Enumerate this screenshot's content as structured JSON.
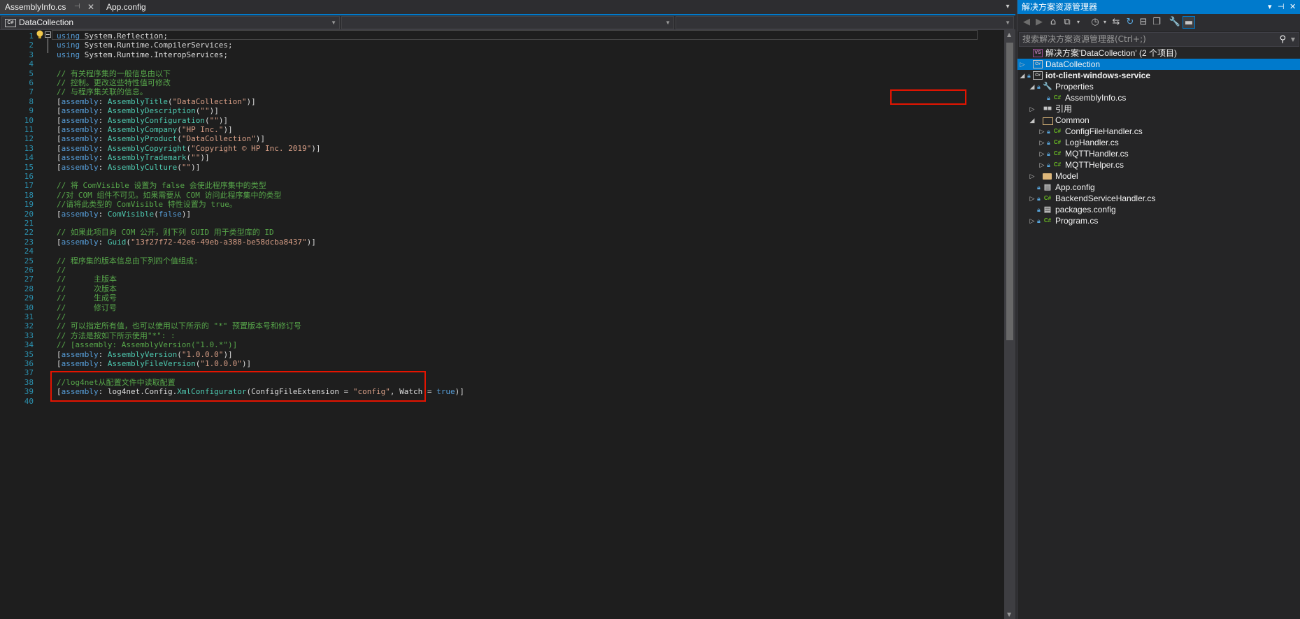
{
  "editor": {
    "tabs": [
      {
        "label": "AssemblyInfo.cs",
        "active": true
      },
      {
        "label": "App.config",
        "active": false
      }
    ],
    "nav": {
      "project": "DataCollection",
      "type": "",
      "member": ""
    },
    "lines": [
      {
        "n": "1",
        "segs": [
          [
            "kw",
            "using"
          ],
          [
            "pl",
            " System.Reflection;"
          ]
        ]
      },
      {
        "n": "2",
        "segs": [
          [
            "kw",
            "using"
          ],
          [
            "pl",
            " System.Runtime.CompilerServices;"
          ]
        ]
      },
      {
        "n": "3",
        "segs": [
          [
            "kw",
            "using"
          ],
          [
            "pl",
            " System.Runtime.InteropServices;"
          ]
        ]
      },
      {
        "n": "4",
        "segs": []
      },
      {
        "n": "5",
        "segs": [
          [
            "cm",
            "// 有关程序集的一般信息由以下"
          ]
        ]
      },
      {
        "n": "6",
        "segs": [
          [
            "cm",
            "// 控制。更改这些特性值可修改"
          ]
        ]
      },
      {
        "n": "7",
        "segs": [
          [
            "cm",
            "// 与程序集关联的信息。"
          ]
        ]
      },
      {
        "n": "8",
        "segs": [
          [
            "pl",
            "["
          ],
          [
            "kw",
            "assembly"
          ],
          [
            "pl",
            ": "
          ],
          [
            "ty",
            "AssemblyTitle"
          ],
          [
            "pl",
            "("
          ],
          [
            "st",
            "\"DataCollection\""
          ],
          [
            "pl",
            ")]"
          ]
        ]
      },
      {
        "n": "9",
        "segs": [
          [
            "pl",
            "["
          ],
          [
            "kw",
            "assembly"
          ],
          [
            "pl",
            ": "
          ],
          [
            "ty",
            "AssemblyDescription"
          ],
          [
            "pl",
            "("
          ],
          [
            "st",
            "\"\""
          ],
          [
            "pl",
            ")]"
          ]
        ]
      },
      {
        "n": "10",
        "segs": [
          [
            "pl",
            "["
          ],
          [
            "kw",
            "assembly"
          ],
          [
            "pl",
            ": "
          ],
          [
            "ty",
            "AssemblyConfiguration"
          ],
          [
            "pl",
            "("
          ],
          [
            "st",
            "\"\""
          ],
          [
            "pl",
            ")]"
          ]
        ]
      },
      {
        "n": "11",
        "segs": [
          [
            "pl",
            "["
          ],
          [
            "kw",
            "assembly"
          ],
          [
            "pl",
            ": "
          ],
          [
            "ty",
            "AssemblyCompany"
          ],
          [
            "pl",
            "("
          ],
          [
            "st",
            "\"HP Inc.\""
          ],
          [
            "pl",
            ")]"
          ]
        ]
      },
      {
        "n": "12",
        "segs": [
          [
            "pl",
            "["
          ],
          [
            "kw",
            "assembly"
          ],
          [
            "pl",
            ": "
          ],
          [
            "ty",
            "AssemblyProduct"
          ],
          [
            "pl",
            "("
          ],
          [
            "st",
            "\"DataCollection\""
          ],
          [
            "pl",
            ")]"
          ]
        ]
      },
      {
        "n": "13",
        "segs": [
          [
            "pl",
            "["
          ],
          [
            "kw",
            "assembly"
          ],
          [
            "pl",
            ": "
          ],
          [
            "ty",
            "AssemblyCopyright"
          ],
          [
            "pl",
            "("
          ],
          [
            "st",
            "\"Copyright © HP Inc. 2019\""
          ],
          [
            "pl",
            ")]"
          ]
        ]
      },
      {
        "n": "14",
        "segs": [
          [
            "pl",
            "["
          ],
          [
            "kw",
            "assembly"
          ],
          [
            "pl",
            ": "
          ],
          [
            "ty",
            "AssemblyTrademark"
          ],
          [
            "pl",
            "("
          ],
          [
            "st",
            "\"\""
          ],
          [
            "pl",
            ")]"
          ]
        ]
      },
      {
        "n": "15",
        "segs": [
          [
            "pl",
            "["
          ],
          [
            "kw",
            "assembly"
          ],
          [
            "pl",
            ": "
          ],
          [
            "ty",
            "AssemblyCulture"
          ],
          [
            "pl",
            "("
          ],
          [
            "st",
            "\"\""
          ],
          [
            "pl",
            ")]"
          ]
        ]
      },
      {
        "n": "16",
        "segs": []
      },
      {
        "n": "17",
        "segs": [
          [
            "cm",
            "// 将 ComVisible 设置为 false 会使此程序集中的类型"
          ]
        ]
      },
      {
        "n": "18",
        "segs": [
          [
            "cm",
            "//对 COM 组件不可见。如果需要从 COM 访问此程序集中的类型"
          ]
        ]
      },
      {
        "n": "19",
        "segs": [
          [
            "cm",
            "//请将此类型的 ComVisible 特性设置为 true。"
          ]
        ]
      },
      {
        "n": "20",
        "segs": [
          [
            "pl",
            "["
          ],
          [
            "kw",
            "assembly"
          ],
          [
            "pl",
            ": "
          ],
          [
            "ty",
            "ComVisible"
          ],
          [
            "pl",
            "("
          ],
          [
            "kw",
            "false"
          ],
          [
            "pl",
            ")]"
          ]
        ]
      },
      {
        "n": "21",
        "segs": []
      },
      {
        "n": "22",
        "segs": [
          [
            "cm",
            "// 如果此项目向 COM 公开，则下列 GUID 用于类型库的 ID"
          ]
        ]
      },
      {
        "n": "23",
        "segs": [
          [
            "pl",
            "["
          ],
          [
            "kw",
            "assembly"
          ],
          [
            "pl",
            ": "
          ],
          [
            "ty",
            "Guid"
          ],
          [
            "pl",
            "("
          ],
          [
            "st",
            "\"13f27f72-42e6-49eb-a388-be58dcba8437\""
          ],
          [
            "pl",
            ")]"
          ]
        ]
      },
      {
        "n": "24",
        "segs": []
      },
      {
        "n": "25",
        "segs": [
          [
            "cm",
            "// 程序集的版本信息由下列四个值组成:"
          ]
        ]
      },
      {
        "n": "26",
        "segs": [
          [
            "cm",
            "//"
          ]
        ]
      },
      {
        "n": "27",
        "segs": [
          [
            "cm",
            "//      主版本"
          ]
        ]
      },
      {
        "n": "28",
        "segs": [
          [
            "cm",
            "//      次版本"
          ]
        ]
      },
      {
        "n": "29",
        "segs": [
          [
            "cm",
            "//      生成号"
          ]
        ]
      },
      {
        "n": "30",
        "segs": [
          [
            "cm",
            "//      修订号"
          ]
        ]
      },
      {
        "n": "31",
        "segs": [
          [
            "cm",
            "//"
          ]
        ]
      },
      {
        "n": "32",
        "segs": [
          [
            "cm",
            "// 可以指定所有值，也可以使用以下所示的 \"*\" 预置版本号和修订号"
          ]
        ]
      },
      {
        "n": "33",
        "segs": [
          [
            "cm",
            "// 方法是按如下所示使用\"*\": :"
          ]
        ]
      },
      {
        "n": "34",
        "segs": [
          [
            "cm",
            "// [assembly: AssemblyVersion(\"1.0.*\")]"
          ]
        ]
      },
      {
        "n": "35",
        "segs": [
          [
            "pl",
            "["
          ],
          [
            "kw",
            "assembly"
          ],
          [
            "pl",
            ": "
          ],
          [
            "ty",
            "AssemblyVersion"
          ],
          [
            "pl",
            "("
          ],
          [
            "st",
            "\"1.0.0.0\""
          ],
          [
            "pl",
            ")]"
          ]
        ]
      },
      {
        "n": "36",
        "segs": [
          [
            "pl",
            "["
          ],
          [
            "kw",
            "assembly"
          ],
          [
            "pl",
            ": "
          ],
          [
            "ty",
            "AssemblyFileVersion"
          ],
          [
            "pl",
            "("
          ],
          [
            "st",
            "\"1.0.0.0\""
          ],
          [
            "pl",
            ")]"
          ]
        ]
      },
      {
        "n": "37",
        "segs": []
      },
      {
        "n": "38",
        "segs": [
          [
            "cm",
            "//log4net从配置文件中读取配置"
          ]
        ]
      },
      {
        "n": "39",
        "segs": [
          [
            "pl",
            "["
          ],
          [
            "kw",
            "assembly"
          ],
          [
            "pl",
            ": log4net.Config."
          ],
          [
            "ty",
            "XmlConfigurator"
          ],
          [
            "pl",
            "(ConfigFileExtension = "
          ],
          [
            "st",
            "\"config\""
          ],
          [
            "pl",
            ", Watch = "
          ],
          [
            "kw",
            "true"
          ],
          [
            "pl",
            ")]"
          ]
        ]
      },
      {
        "n": "40",
        "segs": []
      }
    ]
  },
  "solution_explorer": {
    "title": "解决方案资源管理器",
    "search_placeholder": "搜索解决方案资源管理器(Ctrl+;)",
    "items": [
      {
        "label": "解决方案'DataCollection' (2 个项目)",
        "icon": "solution-icon",
        "twisty": "",
        "lock": false,
        "level": 0,
        "bold": false,
        "selected": false
      },
      {
        "label": "DataCollection",
        "icon": "csproj-icon",
        "twisty": "▷",
        "lock": false,
        "level": 0,
        "bold": false,
        "selected": true
      },
      {
        "label": "iot-client-windows-service",
        "icon": "csproj-icon",
        "twisty": "◢",
        "lock": true,
        "level": 0,
        "bold": true,
        "selected": false
      },
      {
        "label": "Properties",
        "icon": "wrench-icon",
        "twisty": "◢",
        "lock": true,
        "level": 1,
        "bold": false,
        "selected": false
      },
      {
        "label": "AssemblyInfo.cs",
        "icon": "csfile-icon",
        "twisty": "",
        "lock": true,
        "level": 2,
        "bold": false,
        "selected": false
      },
      {
        "label": "引用",
        "icon": "references-icon",
        "twisty": "▷",
        "lock": false,
        "level": 1,
        "bold": false,
        "selected": false
      },
      {
        "label": "Common",
        "icon": "folder-open-icon",
        "twisty": "◢",
        "lock": false,
        "level": 1,
        "bold": false,
        "selected": false
      },
      {
        "label": "ConfigFileHandler.cs",
        "icon": "csfile-icon",
        "twisty": "▷",
        "lock": true,
        "level": 2,
        "bold": false,
        "selected": false
      },
      {
        "label": "LogHandler.cs",
        "icon": "csfile-icon",
        "twisty": "▷",
        "lock": true,
        "level": 2,
        "bold": false,
        "selected": false
      },
      {
        "label": "MQTTHandler.cs",
        "icon": "csfile-icon",
        "twisty": "▷",
        "lock": true,
        "level": 2,
        "bold": false,
        "selected": false
      },
      {
        "label": "MQTTHelper.cs",
        "icon": "csfile-icon",
        "twisty": "▷",
        "lock": true,
        "level": 2,
        "bold": false,
        "selected": false
      },
      {
        "label": "Model",
        "icon": "folder-icon",
        "twisty": "▷",
        "lock": false,
        "level": 1,
        "bold": false,
        "selected": false
      },
      {
        "label": "App.config",
        "icon": "config-icon",
        "twisty": "",
        "lock": true,
        "level": 1,
        "bold": false,
        "selected": false
      },
      {
        "label": "BackendServiceHandler.cs",
        "icon": "csfile-icon",
        "twisty": "▷",
        "lock": true,
        "level": 1,
        "bold": false,
        "selected": false
      },
      {
        "label": "packages.config",
        "icon": "config-icon",
        "twisty": "",
        "lock": true,
        "level": 1,
        "bold": false,
        "selected": false
      },
      {
        "label": "Program.cs",
        "icon": "csfile-icon",
        "twisty": "▷",
        "lock": true,
        "level": 1,
        "bold": false,
        "selected": false
      }
    ]
  },
  "colors": {
    "accent": "#007acc",
    "highlight_box": "#e51400",
    "keyword": "#569cd6",
    "comment": "#57a64a",
    "type": "#4ec9b0",
    "string": "#d69d85",
    "line_number": "#2b91af"
  }
}
